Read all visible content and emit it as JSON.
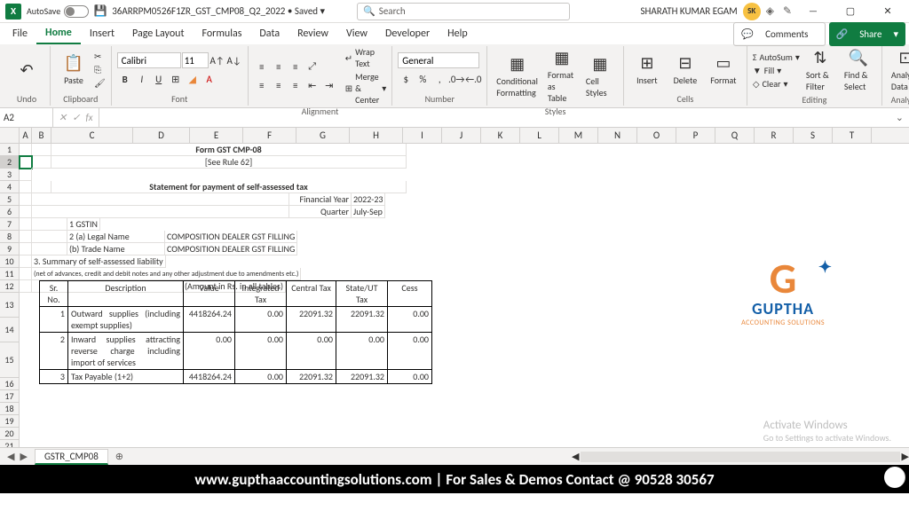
{
  "titlebar": {
    "autosave_label": "AutoSave",
    "autosave_state": "Off",
    "filename": "36ARRPM0526F1ZR_GST_CMP08_Q2_2022 • Saved ▾",
    "search_placeholder": "Search",
    "user_name": "SHARATH KUMAR EGAM",
    "user_initials": "SK"
  },
  "menu": {
    "items": [
      "File",
      "Home",
      "Insert",
      "Page Layout",
      "Formulas",
      "Data",
      "Review",
      "View",
      "Developer",
      "Help"
    ],
    "comments": "Comments",
    "share": "Share"
  },
  "ribbon": {
    "undo": "Undo",
    "paste": "Paste",
    "clipboard": "Clipboard",
    "font_name": "Calibri",
    "font_size": "11",
    "font": "Font",
    "wrap": "Wrap Text",
    "merge": "Merge & Center",
    "alignment": "Alignment",
    "numfmt": "General",
    "number": "Number",
    "cond": "Conditional Formatting",
    "fmttable": "Format as Table",
    "cellstyles": "Cell Styles",
    "styles": "Styles",
    "insert": "Insert",
    "delete": "Delete",
    "format": "Format",
    "cells": "Cells",
    "autosum": "AutoSum",
    "fill": "Fill",
    "clear": "Clear",
    "sort": "Sort & Filter",
    "find": "Find & Select",
    "editing": "Editing",
    "analyze": "Analyze Data",
    "analysis": "Analysis"
  },
  "formula_bar": {
    "cell_ref": "A2"
  },
  "sheet": {
    "title": "Form GST CMP-08",
    "rule": "[See Rule 62]",
    "statement": "Statement for payment of self-assessed tax",
    "fy_label": "Financial Year",
    "fy": "2022-23",
    "q_label": "Quarter",
    "q": "July-Sep",
    "r1": "1 GSTIN",
    "r2a": "2 (a) Legal Name",
    "r2a_val": "COMPOSITION DEALER GST FILLING",
    "r2b": "   (b) Trade Name",
    "r2b_val": "COMPOSITION DEALER GST FILLING",
    "r3": "3. Summary of self-assessed liability",
    "note": "(net of advances, credit and debit notes and any other adjustment due to amendments etc.)",
    "amt": "(Amount in Rs. in all tables)",
    "headers": [
      "Sr. No.",
      "Description",
      "Value",
      "Integrated Tax",
      "Central Tax",
      "State/UT Tax",
      "Cess"
    ],
    "rows": [
      {
        "n": "1",
        "d": "Outward supplies (including exempt supplies)",
        "v": "4418264.24",
        "it": "0.00",
        "ct": "22091.32",
        "st": "22091.32",
        "cs": "0.00"
      },
      {
        "n": "2",
        "d": "Inward supplies attracting reverse charge including import of services",
        "v": "0.00",
        "it": "0.00",
        "ct": "0.00",
        "st": "0.00",
        "cs": "0.00"
      },
      {
        "n": "3",
        "d": "Tax Payable (1+2)",
        "v": "4418264.24",
        "it": "0.00",
        "ct": "22091.32",
        "st": "22091.32",
        "cs": "0.00"
      }
    ]
  },
  "logo": {
    "name": "GUPTHA",
    "sub": "ACCOUNTING SOLUTIONS"
  },
  "activate": {
    "t1": "Activate Windows",
    "t2": "Go to Settings to activate Windows."
  },
  "tabs": {
    "sheet": "GSTR_CMP08"
  },
  "footer": {
    "text": "www.gupthaaccountingsolutions.com | For Sales & Demos Contact @ 90528 30567"
  }
}
